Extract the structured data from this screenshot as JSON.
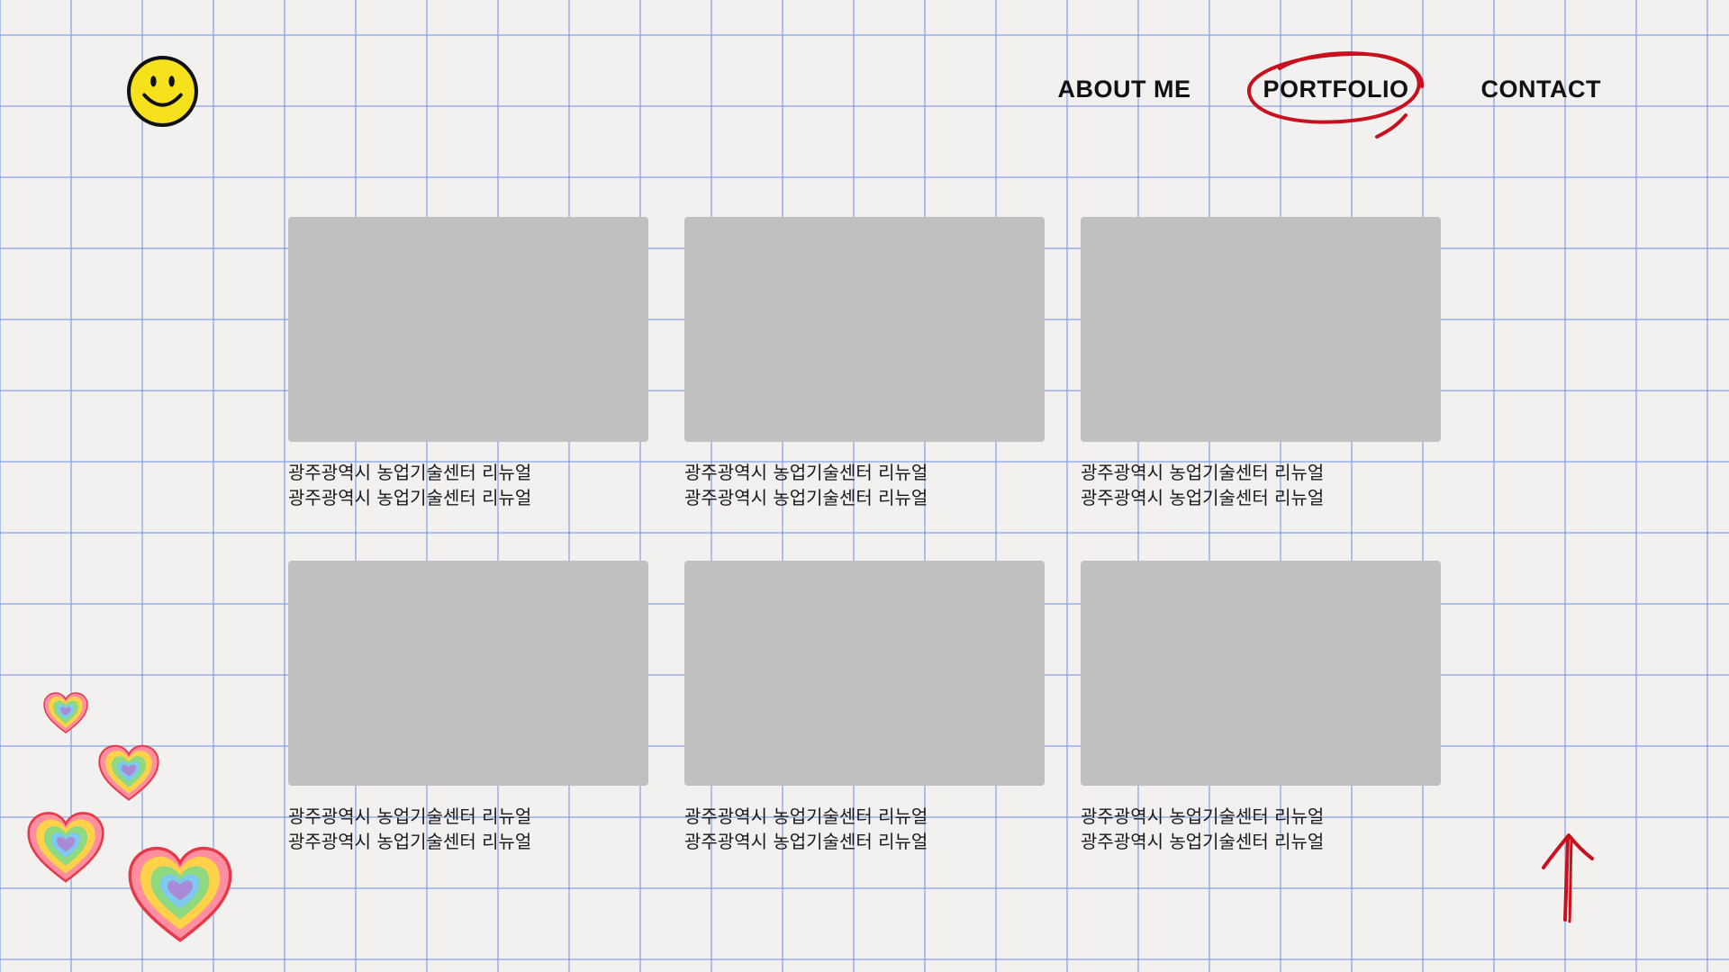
{
  "header": {
    "logo_icon": "smiley-face-icon",
    "nav": [
      {
        "label": "ABOUT ME",
        "active": false
      },
      {
        "label": "PORTFOLIO",
        "active": true
      },
      {
        "label": "CONTACT",
        "active": false
      }
    ]
  },
  "portfolio": {
    "items": [
      {
        "line1": "광주광역시 농업기술센터 리뉴얼",
        "line2": "광주광역시 농업기술센터 리뉴얼"
      },
      {
        "line1": "광주광역시 농업기술센터 리뉴얼",
        "line2": "광주광역시 농업기술센터 리뉴얼"
      },
      {
        "line1": "광주광역시 농업기술센터 리뉴얼",
        "line2": "광주광역시 농업기술센터 리뉴얼"
      },
      {
        "line1": "광주광역시 농업기술센터 리뉴얼",
        "line2": "광주광역시 농업기술센터 리뉴얼"
      },
      {
        "line1": "광주광역시 농업기술센터 리뉴얼",
        "line2": "광주광역시 농업기술센터 리뉴얼"
      },
      {
        "line1": "광주광역시 농업기술센터 리뉴얼",
        "line2": "광주광역시 농업기술센터 리뉴얼"
      }
    ]
  },
  "decor": {
    "hearts_icon": "rainbow-heart-icon",
    "scroll_icon": "arrow-up-icon"
  },
  "colors": {
    "grid_line": "#7896e1",
    "accent_red": "#c8101e",
    "smiley_yellow": "#f6e21c",
    "placeholder_gray": "#c0c0c0"
  }
}
